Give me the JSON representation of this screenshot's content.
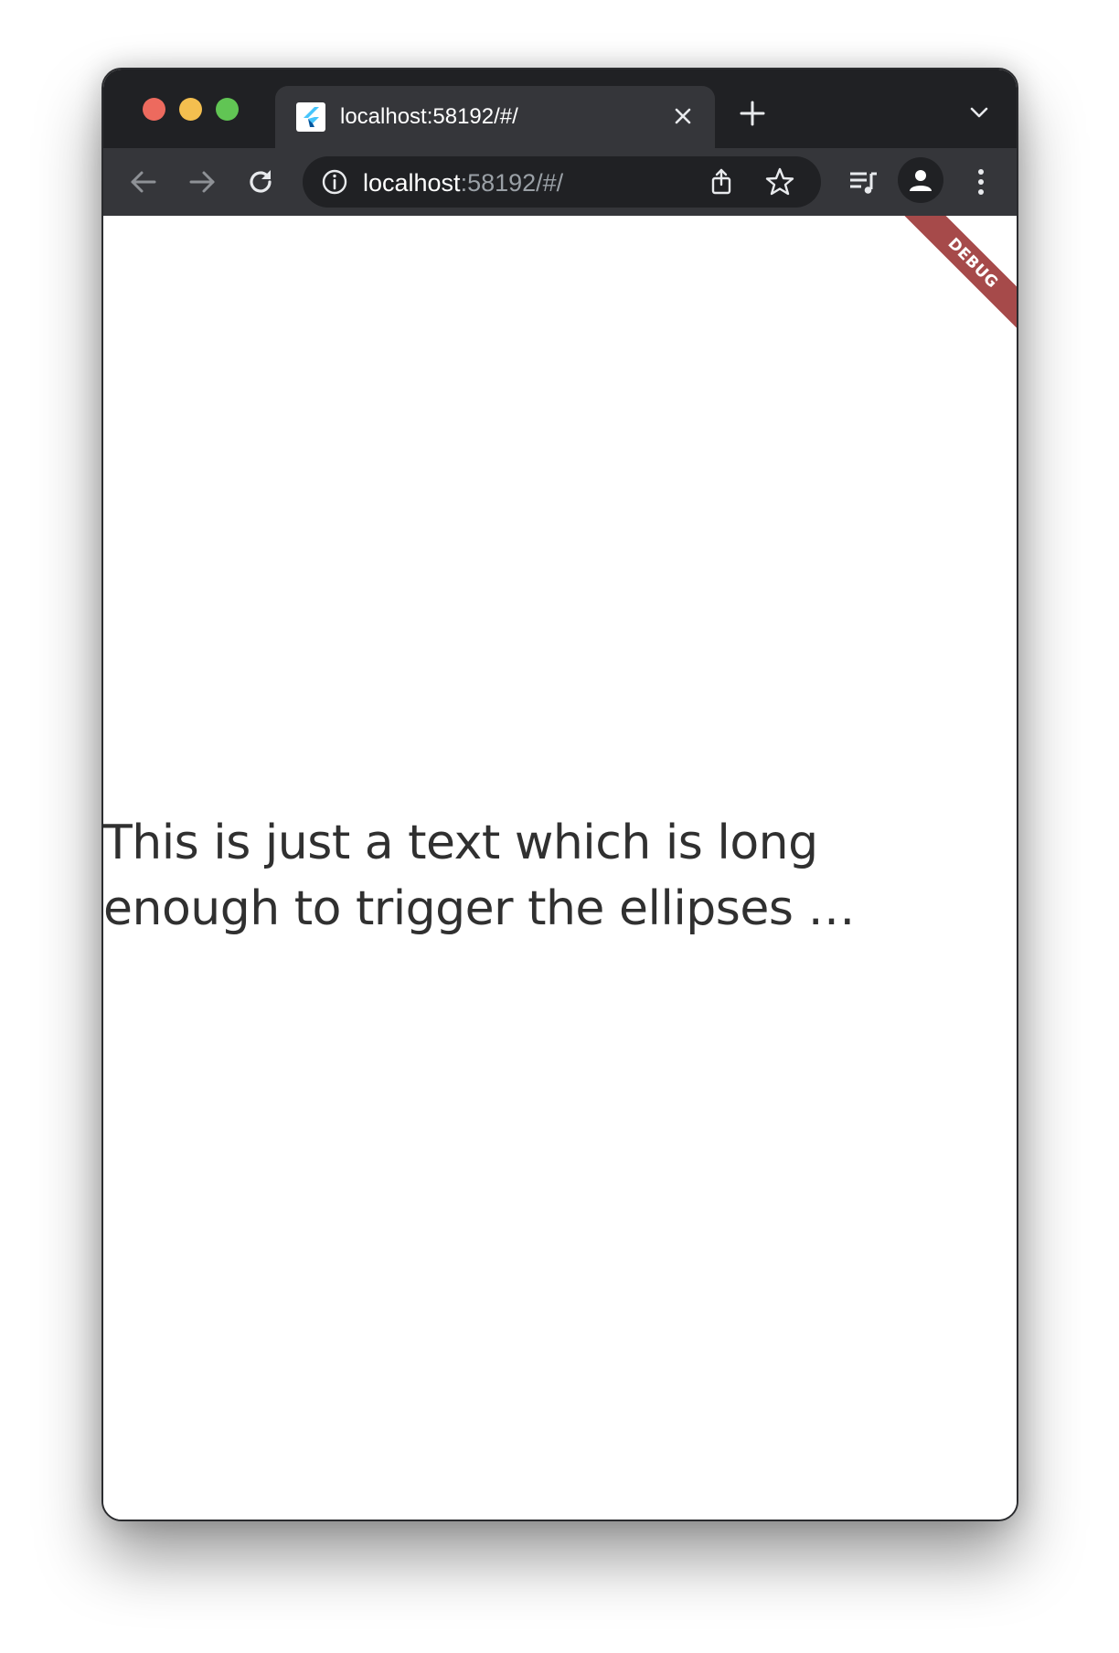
{
  "browser": {
    "tab": {
      "title": "localhost:58192/#/",
      "favicon": "flutter-icon"
    },
    "new_tab_label": "+",
    "address": {
      "host": "localhost",
      "rest": ":58192/#/"
    },
    "icons": {
      "back": "back-arrow-icon",
      "forward": "forward-arrow-icon",
      "reload": "reload-icon",
      "info": "info-icon",
      "share": "share-icon",
      "bookmark": "star-icon",
      "media": "media-queue-icon",
      "profile": "profile-icon",
      "menu": "kebab-menu-icon",
      "tab_search": "chevron-down-icon",
      "close": "close-icon"
    }
  },
  "app": {
    "banner": "DEBUG",
    "text": "This is just a text which is long enough to trigger the ellipses …"
  },
  "colors": {
    "chrome_dark": "#202124",
    "toolbar": "#35363a",
    "banner": "#a64a4a",
    "text": "#303030"
  }
}
